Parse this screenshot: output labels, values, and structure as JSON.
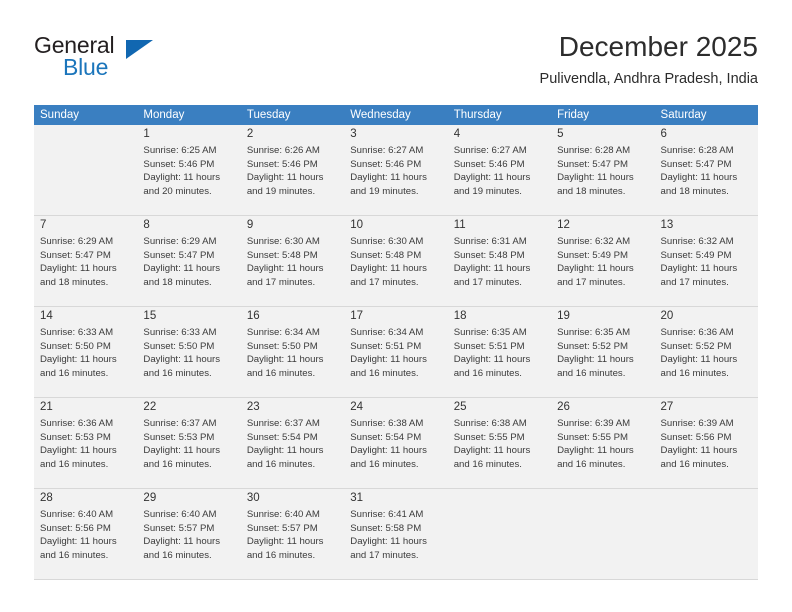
{
  "brand": {
    "name_top": "General",
    "name_bottom": "Blue",
    "triangle_color": "#1167b1",
    "blue_color": "#1b75bb"
  },
  "header": {
    "title": "December 2025",
    "subtitle": "Pulivendla, Andhra Pradesh, India"
  },
  "theme": {
    "header_row_bg": "#3a7fc1",
    "header_row_text": "#ffffff",
    "alt_row_bg": "#f2f2f2",
    "cell_bg": "#ffffff"
  },
  "weekdays": [
    "Sunday",
    "Monday",
    "Tuesday",
    "Wednesday",
    "Thursday",
    "Friday",
    "Saturday"
  ],
  "weeks": [
    [
      {
        "day": "",
        "info": ""
      },
      {
        "day": "1",
        "info": "Sunrise: 6:25 AM\nSunset: 5:46 PM\nDaylight: 11 hours\nand 20 minutes."
      },
      {
        "day": "2",
        "info": "Sunrise: 6:26 AM\nSunset: 5:46 PM\nDaylight: 11 hours\nand 19 minutes."
      },
      {
        "day": "3",
        "info": "Sunrise: 6:27 AM\nSunset: 5:46 PM\nDaylight: 11 hours\nand 19 minutes."
      },
      {
        "day": "4",
        "info": "Sunrise: 6:27 AM\nSunset: 5:46 PM\nDaylight: 11 hours\nand 19 minutes."
      },
      {
        "day": "5",
        "info": "Sunrise: 6:28 AM\nSunset: 5:47 PM\nDaylight: 11 hours\nand 18 minutes."
      },
      {
        "day": "6",
        "info": "Sunrise: 6:28 AM\nSunset: 5:47 PM\nDaylight: 11 hours\nand 18 minutes."
      }
    ],
    [
      {
        "day": "7",
        "info": "Sunrise: 6:29 AM\nSunset: 5:47 PM\nDaylight: 11 hours\nand 18 minutes."
      },
      {
        "day": "8",
        "info": "Sunrise: 6:29 AM\nSunset: 5:47 PM\nDaylight: 11 hours\nand 18 minutes."
      },
      {
        "day": "9",
        "info": "Sunrise: 6:30 AM\nSunset: 5:48 PM\nDaylight: 11 hours\nand 17 minutes."
      },
      {
        "day": "10",
        "info": "Sunrise: 6:30 AM\nSunset: 5:48 PM\nDaylight: 11 hours\nand 17 minutes."
      },
      {
        "day": "11",
        "info": "Sunrise: 6:31 AM\nSunset: 5:48 PM\nDaylight: 11 hours\nand 17 minutes."
      },
      {
        "day": "12",
        "info": "Sunrise: 6:32 AM\nSunset: 5:49 PM\nDaylight: 11 hours\nand 17 minutes."
      },
      {
        "day": "13",
        "info": "Sunrise: 6:32 AM\nSunset: 5:49 PM\nDaylight: 11 hours\nand 17 minutes."
      }
    ],
    [
      {
        "day": "14",
        "info": "Sunrise: 6:33 AM\nSunset: 5:50 PM\nDaylight: 11 hours\nand 16 minutes."
      },
      {
        "day": "15",
        "info": "Sunrise: 6:33 AM\nSunset: 5:50 PM\nDaylight: 11 hours\nand 16 minutes."
      },
      {
        "day": "16",
        "info": "Sunrise: 6:34 AM\nSunset: 5:50 PM\nDaylight: 11 hours\nand 16 minutes."
      },
      {
        "day": "17",
        "info": "Sunrise: 6:34 AM\nSunset: 5:51 PM\nDaylight: 11 hours\nand 16 minutes."
      },
      {
        "day": "18",
        "info": "Sunrise: 6:35 AM\nSunset: 5:51 PM\nDaylight: 11 hours\nand 16 minutes."
      },
      {
        "day": "19",
        "info": "Sunrise: 6:35 AM\nSunset: 5:52 PM\nDaylight: 11 hours\nand 16 minutes."
      },
      {
        "day": "20",
        "info": "Sunrise: 6:36 AM\nSunset: 5:52 PM\nDaylight: 11 hours\nand 16 minutes."
      }
    ],
    [
      {
        "day": "21",
        "info": "Sunrise: 6:36 AM\nSunset: 5:53 PM\nDaylight: 11 hours\nand 16 minutes."
      },
      {
        "day": "22",
        "info": "Sunrise: 6:37 AM\nSunset: 5:53 PM\nDaylight: 11 hours\nand 16 minutes."
      },
      {
        "day": "23",
        "info": "Sunrise: 6:37 AM\nSunset: 5:54 PM\nDaylight: 11 hours\nand 16 minutes."
      },
      {
        "day": "24",
        "info": "Sunrise: 6:38 AM\nSunset: 5:54 PM\nDaylight: 11 hours\nand 16 minutes."
      },
      {
        "day": "25",
        "info": "Sunrise: 6:38 AM\nSunset: 5:55 PM\nDaylight: 11 hours\nand 16 minutes."
      },
      {
        "day": "26",
        "info": "Sunrise: 6:39 AM\nSunset: 5:55 PM\nDaylight: 11 hours\nand 16 minutes."
      },
      {
        "day": "27",
        "info": "Sunrise: 6:39 AM\nSunset: 5:56 PM\nDaylight: 11 hours\nand 16 minutes."
      }
    ],
    [
      {
        "day": "28",
        "info": "Sunrise: 6:40 AM\nSunset: 5:56 PM\nDaylight: 11 hours\nand 16 minutes."
      },
      {
        "day": "29",
        "info": "Sunrise: 6:40 AM\nSunset: 5:57 PM\nDaylight: 11 hours\nand 16 minutes."
      },
      {
        "day": "30",
        "info": "Sunrise: 6:40 AM\nSunset: 5:57 PM\nDaylight: 11 hours\nand 16 minutes."
      },
      {
        "day": "31",
        "info": "Sunrise: 6:41 AM\nSunset: 5:58 PM\nDaylight: 11 hours\nand 17 minutes."
      },
      {
        "day": "",
        "info": ""
      },
      {
        "day": "",
        "info": ""
      },
      {
        "day": "",
        "info": ""
      }
    ]
  ]
}
